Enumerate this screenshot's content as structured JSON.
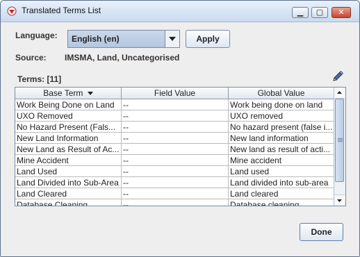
{
  "window": {
    "title": "Translated Terms List"
  },
  "language": {
    "label": "Language:",
    "selected": "English (en)",
    "apply_label": "Apply"
  },
  "source": {
    "label": "Source:",
    "value": "IMSMA, Land, Uncategorised"
  },
  "terms": {
    "label": "Terms: [11]"
  },
  "table": {
    "columns": [
      "Base Term",
      "Field Value",
      "Global Value"
    ],
    "rows": [
      [
        "Work Being Done on Land",
        "--",
        "Work being done on land"
      ],
      [
        "UXO Removed",
        "--",
        "UXO removed"
      ],
      [
        "No Hazard Present (Fals...",
        "--",
        "No hazard present (false i..."
      ],
      [
        "New Land Information",
        "--",
        "New land information"
      ],
      [
        "New Land as Result of Ac...",
        "--",
        "New land as result of acti..."
      ],
      [
        "Mine Accident",
        "--",
        "Mine accident"
      ],
      [
        "Land Used",
        "--",
        "Land used"
      ],
      [
        "Land Divided into Sub-Area",
        "--",
        "Land divided into sub-area"
      ],
      [
        "Land Cleared",
        "--",
        "Land cleared"
      ],
      [
        "Database Cleaning",
        "--",
        "Database cleaning"
      ]
    ]
  },
  "footer": {
    "done_label": "Done"
  },
  "colors": {
    "accent": "#b4c7de",
    "titlebar": "#c9daef",
    "close": "#c6452b"
  }
}
